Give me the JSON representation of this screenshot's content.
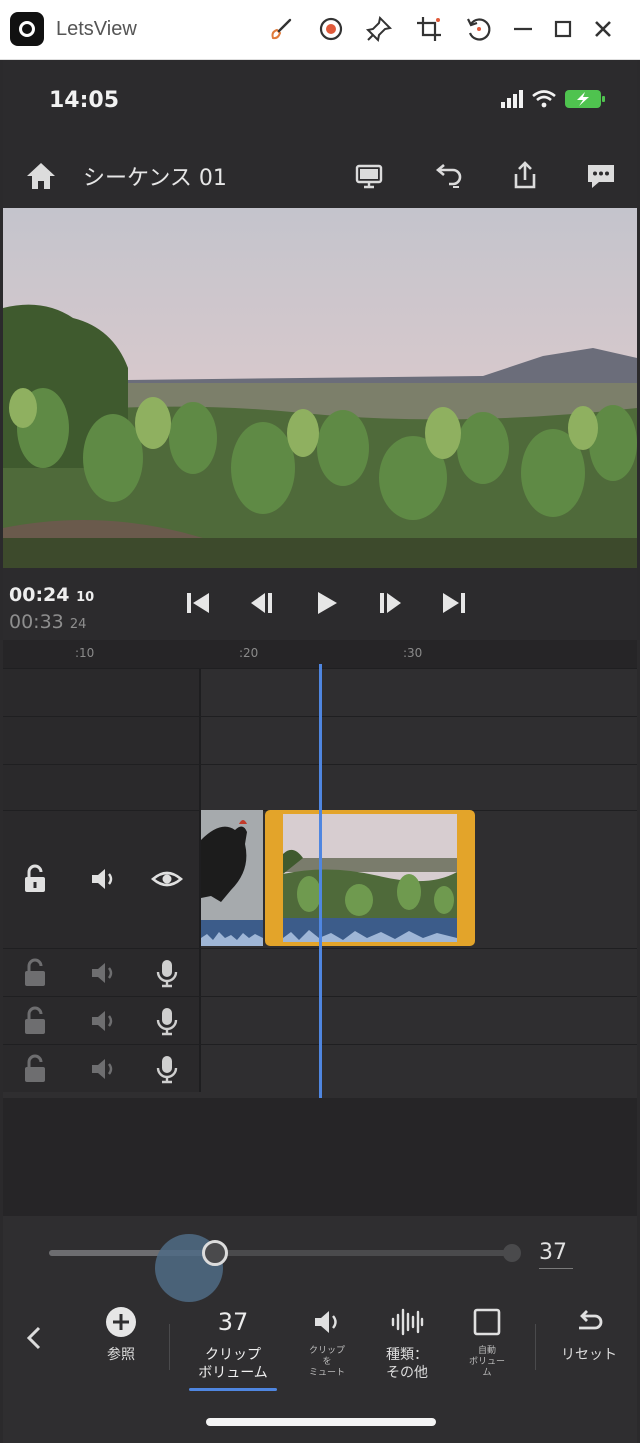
{
  "window": {
    "app_title": "LetsView"
  },
  "status": {
    "time": "14:05"
  },
  "header": {
    "sequence_title": "シーケンス 01"
  },
  "timecode": {
    "current_main": "00:24",
    "current_frame": "10",
    "total_main": "00:33",
    "total_frame": "24"
  },
  "ruler": {
    "ticks": [
      ":10",
      ":20",
      ":30"
    ]
  },
  "volume": {
    "value": "37",
    "level_percent": 37
  },
  "toolbar": {
    "browse_label": "参照",
    "clip_volume_value": "37",
    "clip_volume_label": "クリップ\nボリューム",
    "mute_clip_label": "クリップ\nを\nミュート",
    "type_label": "種類：\nその他",
    "auto_volume_label": "自動\nボリュー\nム",
    "reset_label": "リセット"
  },
  "colors": {
    "accent": "#4f86e0",
    "clip_border": "#e3a42a"
  }
}
